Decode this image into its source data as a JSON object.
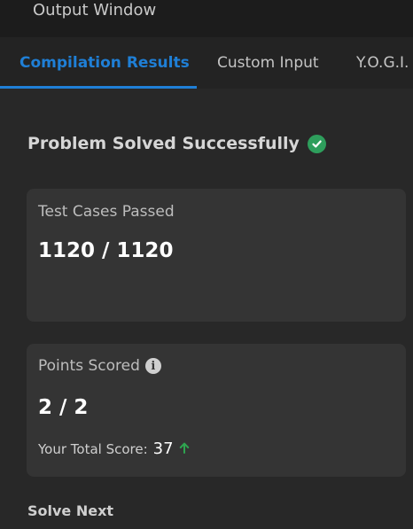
{
  "window": {
    "title": "Output Window"
  },
  "tabs": [
    {
      "label": "Compilation Results",
      "active": true
    },
    {
      "label": "Custom Input",
      "active": false
    },
    {
      "label": "Y.O.G.I.",
      "active": false
    }
  ],
  "status": {
    "text": "Problem Solved Successfully",
    "icon": "check-circle-icon"
  },
  "test_cases": {
    "label": "Test Cases Passed",
    "value": "1120 / 1120"
  },
  "points": {
    "label": "Points Scored",
    "info_icon": "info-icon",
    "value": "2 / 2",
    "total_label": "Your Total Score:",
    "total_value": "37",
    "trend_icon": "arrow-up-icon"
  },
  "solve_next": {
    "label": "Solve Next"
  },
  "colors": {
    "accent": "#1f7fd6",
    "success": "#2e9e5c",
    "card_bg": "#343434",
    "page_bg": "#282828"
  }
}
